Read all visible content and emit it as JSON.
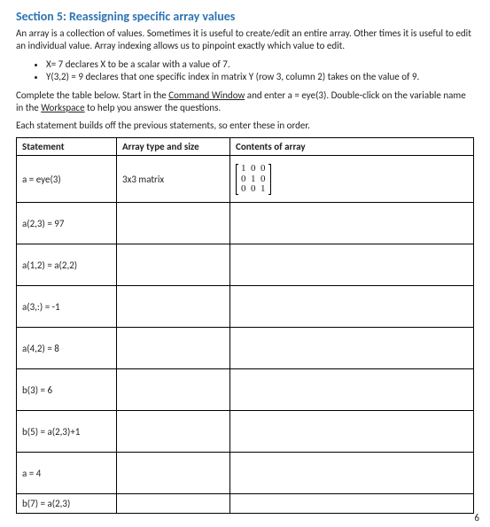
{
  "section": {
    "title": "Section 5: Reassigning specific array values",
    "intro": "An array is a collection of values. Sometimes it is useful to create/edit an entire array. Other times it is useful to edit an individual value. Array indexing allows us to pinpoint exactly which value to edit.",
    "bullets": [
      "X= 7 declares X to be a scalar with a value of 7.",
      "Y(3,2) = 9 declares that one specific index in matrix Y (row 3, column 2) takes on the value of 9."
    ],
    "instructions_a": "Complete the table below. Start in the ",
    "cmd_win": "Command Window",
    "instructions_b": " and enter a = eye(3). Double-click on the variable name in the ",
    "workspace": "Workspace",
    "instructions_c": " to help you answer the questions.",
    "builds_off": "Each statement builds off the previous statements, so enter these in order."
  },
  "table": {
    "headers": {
      "stmt": "Statement",
      "type": "Array type and size",
      "contents": "Contents of array"
    },
    "rows": [
      {
        "stmt": "a = eye(3)",
        "type": "3x3 matrix",
        "contents_matrix": "1  0  0\n0  1  0\n0  0  1"
      },
      {
        "stmt": "a(2,3) = 97",
        "type": "",
        "contents_matrix": ""
      },
      {
        "stmt": "a(1,2) = a(2,2)",
        "type": "",
        "contents_matrix": ""
      },
      {
        "stmt": "a(3,:) = -1",
        "type": "",
        "contents_matrix": ""
      },
      {
        "stmt": "a(4,2) = 8",
        "type": "",
        "contents_matrix": ""
      },
      {
        "stmt": "b(3) = 6",
        "type": "",
        "contents_matrix": ""
      },
      {
        "stmt": "b(5) = a(2,3)+1",
        "type": "",
        "contents_matrix": ""
      },
      {
        "stmt": "a = 4",
        "type": "",
        "contents_matrix": ""
      },
      {
        "stmt": "b(7) = a(2,3)",
        "type": "",
        "contents_matrix": ""
      }
    ]
  },
  "page_number": "6"
}
